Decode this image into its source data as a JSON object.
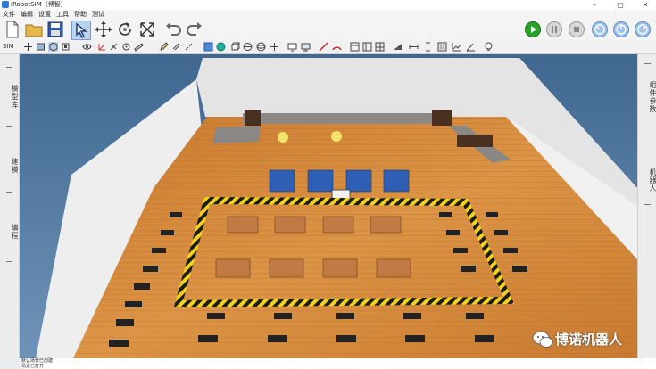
{
  "window": {
    "title": "iRobotSIM（博智）",
    "minimize": "–",
    "maximize": "▢",
    "close": "✕"
  },
  "menu": [
    "文件",
    "编辑",
    "设置",
    "工具",
    "帮助",
    "测试"
  ],
  "toolbar": {
    "sim_label": "SIM"
  },
  "left_panel": {
    "tabs": [
      "模型库",
      "建模",
      "编程"
    ]
  },
  "right_panel": {
    "tabs": [
      "组件参数",
      "机器人"
    ]
  },
  "status": {
    "lines": [
      "默认场景已创建",
      "场景已打开"
    ]
  },
  "watermark": {
    "text": "博诺机器人",
    "icon": "wechat-icon"
  },
  "colors": {
    "floor": "#d98d3a",
    "walls": "#f2f2f2",
    "play": "#2aa12a",
    "sky": "#4a6f9a"
  }
}
